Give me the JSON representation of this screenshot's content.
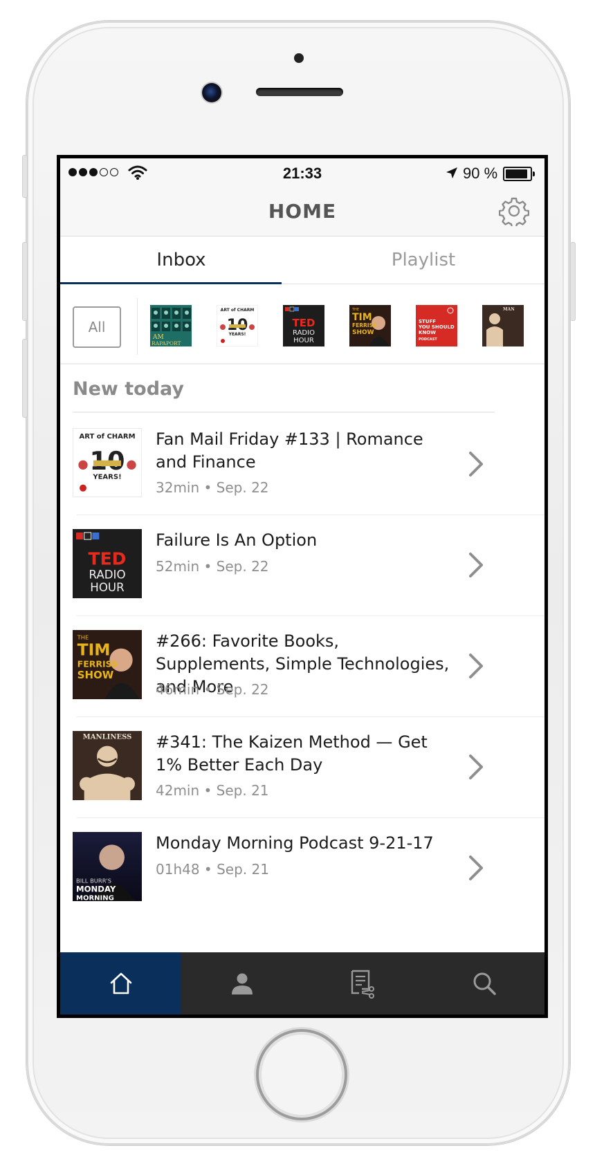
{
  "status_bar": {
    "time": "21:33",
    "battery_percent": "90 %",
    "battery_level": 0.9,
    "signal_bars_filled": 3,
    "signal_bars_total": 5
  },
  "header": {
    "title": "HOME",
    "settings_icon": "gear-icon"
  },
  "tabs": [
    {
      "label": "Inbox",
      "active": true
    },
    {
      "label": "Playlist",
      "active": false
    }
  ],
  "filter_bar": {
    "all_label": "All",
    "podcasts": [
      {
        "icon": "i-am-rapaport-cover",
        "text": "AM RAPAPORT",
        "color": "#1f7a6e"
      },
      {
        "icon": "art-of-charm-cover",
        "text": "ART of CHARM 10 YEARS!",
        "color": "#ffffff"
      },
      {
        "icon": "ted-radio-hour-cover",
        "text": "TED RADIO HOUR",
        "color": "#1d1d1d"
      },
      {
        "icon": "tim-ferriss-show-cover",
        "text": "THE TIM FERRISS SHOW",
        "color": "#c8a218"
      },
      {
        "icon": "stuff-you-should-know-cover",
        "text": "STUFF YOU SHOULD KNOW PODCAST",
        "color": "#d62b25"
      },
      {
        "icon": "art-of-manliness-cover",
        "text": "MAN",
        "color": "#3a2a22"
      }
    ]
  },
  "section": {
    "title": "New today"
  },
  "episodes": [
    {
      "title": "Fan Mail Friday #133 | Romance and Finance",
      "meta": "32min • Sep. 22",
      "art": "art-of-charm-cover"
    },
    {
      "title": "Failure Is An Option",
      "meta": "52min • Sep. 22",
      "art": "ted-radio-hour-cover"
    },
    {
      "title": "#266: Favorite Books, Supplements, Simple Technologies, and More",
      "meta": "46min • Sep. 22",
      "art": "tim-ferriss-show-cover"
    },
    {
      "title": "#341: The Kaizen Method — Get 1% Better Each Day",
      "meta": "42min • Sep. 21",
      "art": "art-of-manliness-cover"
    },
    {
      "title": "Monday Morning Podcast 9-21-17",
      "meta": "01h48 • Sep. 21",
      "art": "bill-burr-monday-morning-cover"
    }
  ],
  "bottom_nav": [
    {
      "icon": "home-icon",
      "active": true
    },
    {
      "icon": "profile-icon",
      "active": false
    },
    {
      "icon": "playlist-edit-icon",
      "active": false
    },
    {
      "icon": "search-icon",
      "active": false
    }
  ],
  "colors": {
    "accent": "#0b2f5b",
    "nav_background": "#2a2a2a",
    "muted_text": "#8e8e8e"
  }
}
